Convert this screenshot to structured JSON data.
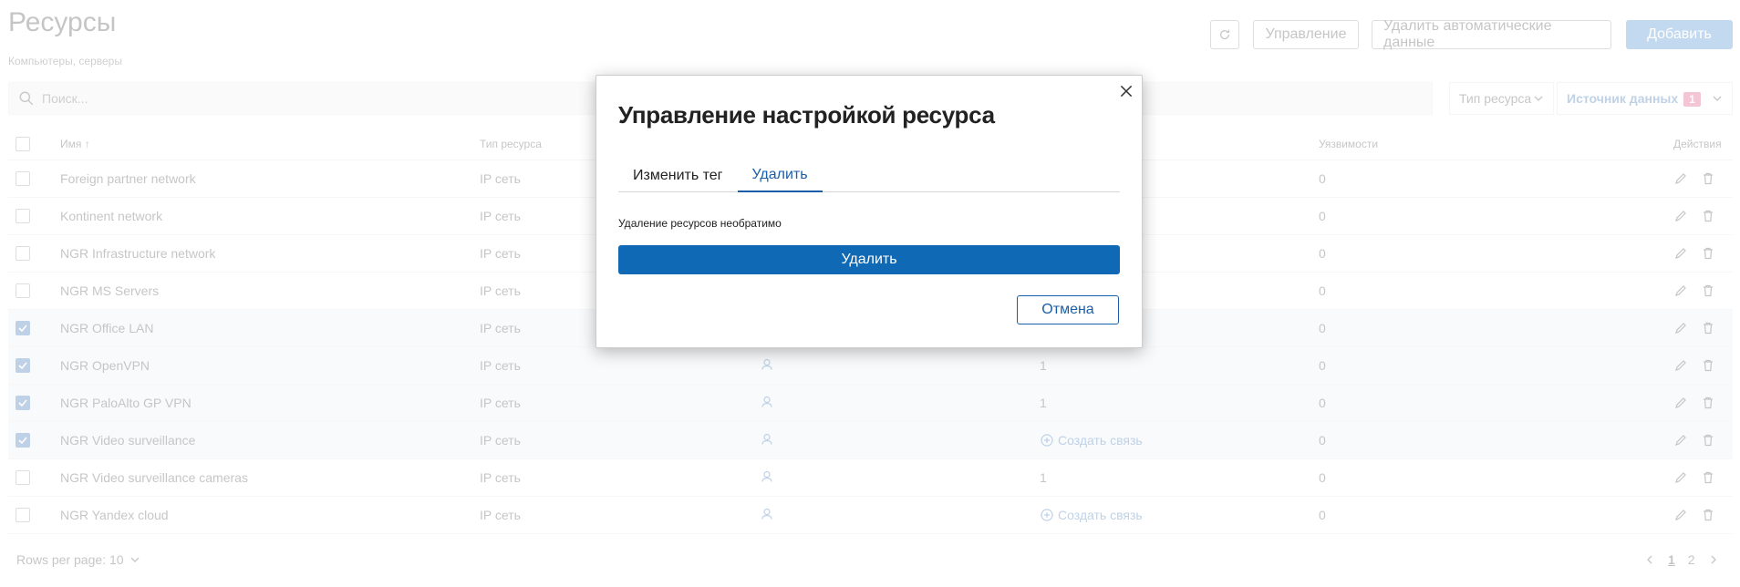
{
  "page": {
    "title": "Ресурсы",
    "subtitle": "Компьютеры, серверы",
    "buttons": {
      "manage": "Управление",
      "delete_auto": "Удалить автоматические данные",
      "add": "Добавить"
    },
    "search": {
      "placeholder": "Поиск..."
    },
    "filters": {
      "resource_type": "Тип ресурса",
      "data_source": "Источник данных",
      "data_source_count": "1"
    },
    "table": {
      "headers": {
        "name": "Имя ↑",
        "type": "Тип ресурса",
        "vulnerabilities": "Уязвимости",
        "actions": "Действия"
      },
      "rows": [
        {
          "name": "Foreign partner network",
          "type": "IP сеть",
          "links": "",
          "vuln": "0",
          "selected": false,
          "owner_icon": false
        },
        {
          "name": "Kontinent network",
          "type": "IP сеть",
          "links": "",
          "vuln": "0",
          "selected": false,
          "owner_icon": false
        },
        {
          "name": "NGR Infrastructure network",
          "type": "IP сеть",
          "links": "",
          "vuln": "0",
          "selected": false,
          "owner_icon": false
        },
        {
          "name": "NGR MS Servers",
          "type": "IP сеть",
          "links": "",
          "vuln": "0",
          "selected": false,
          "owner_icon": false
        },
        {
          "name": "NGR Office LAN",
          "type": "IP сеть",
          "links": "",
          "vuln": "0",
          "selected": true,
          "owner_icon": false
        },
        {
          "name": "NGR OpenVPN",
          "type": "IP сеть",
          "links": "1",
          "vuln": "0",
          "selected": true,
          "owner_icon": true
        },
        {
          "name": "NGR PaloAlto GP VPN",
          "type": "IP сеть",
          "links": "1",
          "vuln": "0",
          "selected": true,
          "owner_icon": true
        },
        {
          "name": "NGR Video surveillance",
          "type": "IP сеть",
          "links": "Создать связь",
          "vuln": "0",
          "selected": true,
          "owner_icon": true
        },
        {
          "name": "NGR Video surveillance cameras",
          "type": "IP сеть",
          "links": "1",
          "vuln": "0",
          "selected": false,
          "owner_icon": true
        },
        {
          "name": "NGR Yandex cloud",
          "type": "IP сеть",
          "links": "Создать связь",
          "vuln": "0",
          "selected": false,
          "owner_icon": true
        }
      ]
    },
    "footer": {
      "rows_per_page": "Rows per page: 10"
    },
    "pagination": {
      "pages": [
        "1",
        "2"
      ],
      "current": "1"
    }
  },
  "dialog": {
    "title": "Управление настройкой ресурса",
    "tabs": [
      "Изменить тег",
      "Удалить"
    ],
    "active_tab": "Удалить",
    "warning": "Удаление ресурсов необратимо",
    "confirm_label": "Удалить",
    "cancel_label": "Отмена"
  },
  "colors": {
    "accent": "#1b5ea8",
    "danger_button": "#0f69b4",
    "selected_row": "#e8eef6",
    "badge": "#d6336c"
  }
}
